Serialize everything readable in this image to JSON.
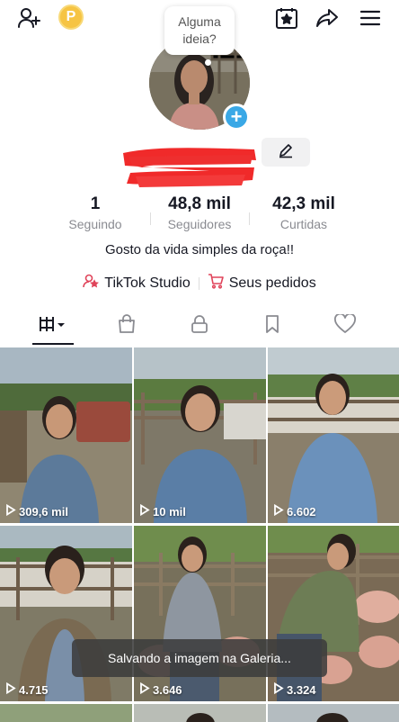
{
  "profile": {
    "bubble_text": "Alguma ideia?",
    "bio": "Gosto da vida simples da roça!!"
  },
  "stats": [
    {
      "value": "1",
      "label": "Seguindo"
    },
    {
      "value": "48,8 mil",
      "label": "Seguidores"
    },
    {
      "value": "42,3 mil",
      "label": "Curtidas"
    }
  ],
  "links": {
    "studio": "TikTok Studio",
    "orders": "Seus pedidos"
  },
  "coin_letter": "P",
  "videos": [
    {
      "views": "309,6 mil"
    },
    {
      "views": "10 mil"
    },
    {
      "views": "6.602"
    },
    {
      "views": "4.715"
    },
    {
      "views": "3.646"
    },
    {
      "views": "3.324"
    }
  ],
  "toast": "Salvando a imagem na Galeria...",
  "colors": {
    "accent": "#fe2c55",
    "plus_blue": "#3aa8e6",
    "coin": "#f6c443"
  }
}
